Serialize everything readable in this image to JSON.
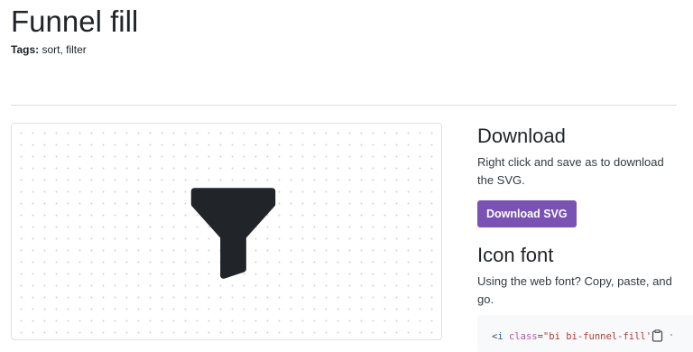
{
  "page": {
    "title": "Funnel fill",
    "tags_label": "Tags:",
    "tags_value": " sort, filter"
  },
  "preview": {
    "icon": "funnel-fill-icon",
    "icon_color": "#212529"
  },
  "download": {
    "heading": "Download",
    "description": "Right click and save as to download the SVG.",
    "button_label": "Download SVG",
    "button_color": "#7952b3"
  },
  "icon_font": {
    "heading": "Icon font",
    "description": "Using the web font? Copy, paste, and go.",
    "code": {
      "open": "<",
      "tag": "i",
      "space": " ",
      "attr": "class",
      "eq": "=",
      "value": "\"bi bi-funnel-fill'"
    },
    "copy_icon": "clipboard-icon"
  }
}
